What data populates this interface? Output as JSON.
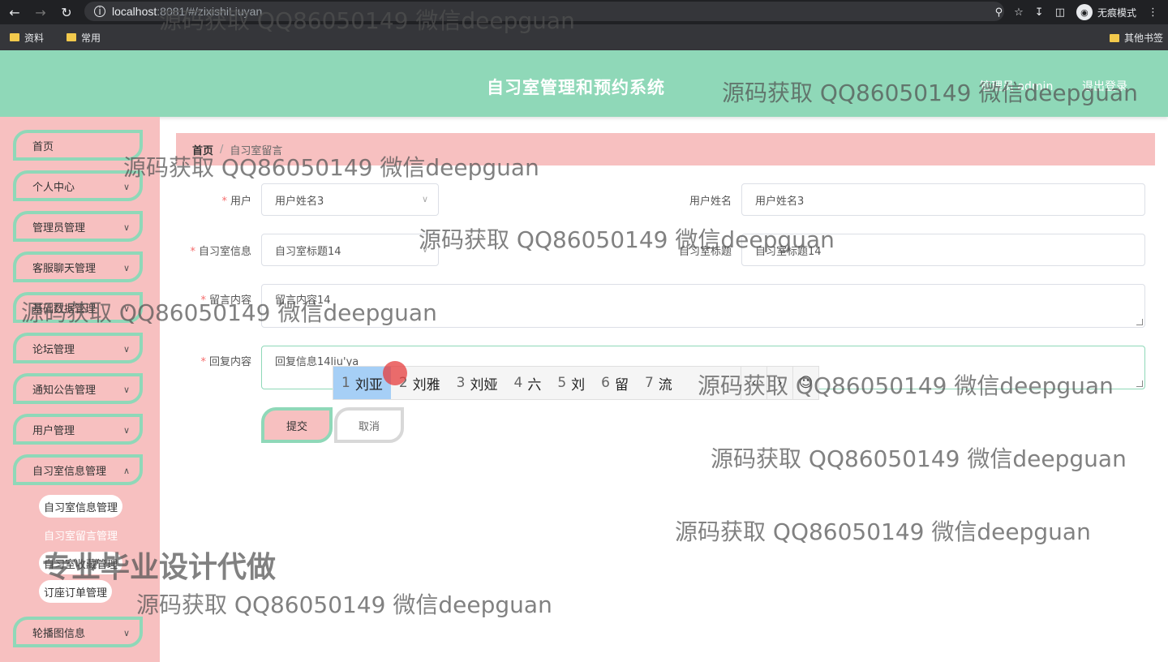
{
  "browser": {
    "url_host": "localhost",
    "url_rest": ":8081/#/zixishiLiuyan",
    "incognito_label": "无痕模式",
    "bookmarks": [
      "资料",
      "常用"
    ],
    "other_bookmarks": "其他书签"
  },
  "header": {
    "title": "自习室管理和预约系统",
    "user": "管理员 admin",
    "logout": "退出登录"
  },
  "sidebar": {
    "items": [
      {
        "label": "首页"
      },
      {
        "label": "个人中心"
      },
      {
        "label": "管理员管理"
      },
      {
        "label": "客服聊天管理"
      },
      {
        "label": "基础数据管理"
      },
      {
        "label": "论坛管理"
      },
      {
        "label": "通知公告管理"
      },
      {
        "label": "用户管理"
      },
      {
        "label": "自习室信息管理"
      },
      {
        "label": "轮播图信息"
      }
    ],
    "subitems": [
      {
        "label": "自习室信息管理"
      },
      {
        "label": "自习室留言管理"
      },
      {
        "label": "自习室收藏管理"
      },
      {
        "label": "订座订单管理"
      }
    ]
  },
  "breadcrumb": {
    "home": "首页",
    "sep": "/",
    "current": "自习室留言"
  },
  "form": {
    "user_label": "用户",
    "user_value": "用户姓名3",
    "username_label": "用户姓名",
    "username_value": "用户姓名3",
    "room_label": "自习室信息",
    "room_value": "自习室标题14",
    "room_title_label": "自习室标题",
    "room_title_value": "自习室标题14",
    "message_label": "留言内容",
    "message_value": "留言内容14",
    "reply_label": "回复内容",
    "reply_value": "回复信息14liu'ya",
    "required_mark": "*",
    "submit": "提交",
    "cancel": "取消"
  },
  "ime": {
    "candidates": [
      {
        "num": "1",
        "text": "刘亚"
      },
      {
        "num": "2",
        "text": "刘雅"
      },
      {
        "num": "3",
        "text": "刘娅"
      },
      {
        "num": "4",
        "text": "六"
      },
      {
        "num": "5",
        "text": "刘"
      },
      {
        "num": "6",
        "text": "留"
      },
      {
        "num": "7",
        "text": "流"
      }
    ],
    "prev": "‹",
    "next": "›",
    "emoji": "☺"
  },
  "watermark": {
    "text": "源码获取 QQ86050149 微信deepguan",
    "big": "专业毕业设计代做"
  }
}
